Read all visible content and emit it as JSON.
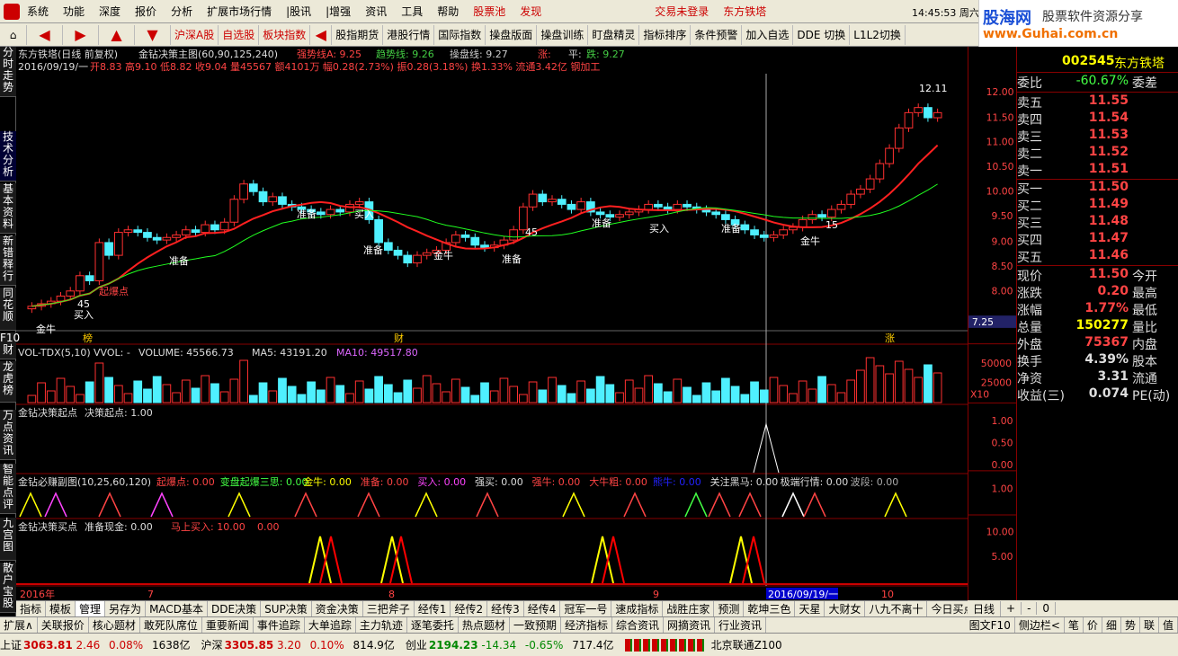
{
  "menu": [
    "系统",
    "功能",
    "深度",
    "报价",
    "分析",
    "扩展市场行情",
    "|股讯",
    "|增强",
    "资讯",
    "工具",
    "帮助",
    "股票池",
    "发现"
  ],
  "menu_right": {
    "login": "交易未登录",
    "stock": "东方铁塔",
    "time": "14:45:53 周六"
  },
  "logo": {
    "name": "股海网",
    "tagline": "股票软件资源分享",
    "url": "www.Guhai.com.cn"
  },
  "toolbar": [
    "沪深A股",
    "自选股",
    "板块指数",
    "股指期货",
    "港股行情",
    "国际指数",
    "操盘版面",
    "操盘训练",
    "盯盘精灵",
    "指标排序",
    "条件预警",
    "加入自选",
    "DDE 切换",
    "L1L2切换"
  ],
  "left_tabs": [
    "分时走势",
    "技术分析",
    "基本资料",
    "新错释行",
    "同花顺",
    "F10财",
    "龙虎榜",
    "万点资讯",
    "智能点评",
    "九宫图",
    "散户宝股"
  ],
  "header": {
    "title": "东方铁塔(日线 前复权)",
    "indicator": "金钻决策主图(60,90,125,240)",
    "s1": "强势线A: 9.25",
    "s2": "趋势线: 9.26",
    "s3": "操盘线: 9.27",
    "s4": "涨:",
    "s5": "平:",
    "s6": "跌: 9.27",
    "date": "2016/09/19/一",
    "quote": "开8.83 高9.10 低8.82 收9.04 量45567 额4101万 幅0.28(2.73%) 振0.28(3.18%) 换1.33% 流通3.42亿 钢加工"
  },
  "vol": {
    "name": "VOL-TDX(5,10)",
    "vvol": "VVOL: -",
    "volume": "VOLUME: 45566.73",
    "ma5": "MA5: 43191.20",
    "ma10": "MA10: 49517.80"
  },
  "p3": {
    "name": "金钻决策起点",
    "val": "决策起点: 1.00"
  },
  "p4": {
    "name": "金钻必赚副图(10,25,60,120)",
    "items": [
      "起爆点: 0.00",
      "变盘起爆三思: 0.00",
      "金牛: 0.00",
      "准备: 0.00",
      "买入: 0.00",
      "强买: 0.00",
      "强牛: 0.00",
      "大牛粗: 0.00",
      "熊牛: 0.00",
      "关注黑马: 0.00",
      "极端行情: 0.00",
      "波段: 0.00"
    ]
  },
  "p5": {
    "name": "金钻决策买点",
    "items": [
      "准备现金: 0.00",
      "马上买入: 10.00",
      "0.00"
    ]
  },
  "axis_main": [
    "12.00",
    "11.50",
    "11.00",
    "10.50",
    "10.00",
    "9.50",
    "9.00",
    "8.50",
    "8.00",
    "7.25"
  ],
  "axis_vol": [
    "50000",
    "25000",
    "X10"
  ],
  "axis_p3": [
    "1.00",
    "0.50",
    "0.00"
  ],
  "axis_p4": [
    "1.00"
  ],
  "axis_p5": [
    "10.00",
    "5.00"
  ],
  "time_axis": [
    "2016年",
    "7",
    "8",
    "9",
    "2016/09/19/一",
    "10"
  ],
  "right": {
    "code": "002545",
    "name": "东方铁塔",
    "wb": {
      "l": "委比",
      "v": "-60.67%",
      "r": "委差"
    },
    "asks": [
      {
        "l": "卖五",
        "v": "11.55"
      },
      {
        "l": "卖四",
        "v": "11.54"
      },
      {
        "l": "卖三",
        "v": "11.53"
      },
      {
        "l": "卖二",
        "v": "11.52"
      },
      {
        "l": "卖一",
        "v": "11.51"
      }
    ],
    "bids": [
      {
        "l": "买一",
        "v": "11.50"
      },
      {
        "l": "买二",
        "v": "11.49"
      },
      {
        "l": "买三",
        "v": "11.48"
      },
      {
        "l": "买四",
        "v": "11.47"
      },
      {
        "l": "买五",
        "v": "11.46"
      }
    ],
    "stats": [
      {
        "l": "现价",
        "v": "11.50",
        "r": "今开"
      },
      {
        "l": "涨跌",
        "v": "0.20",
        "r": "最高"
      },
      {
        "l": "涨幅",
        "v": "1.77%",
        "r": "最低"
      },
      {
        "l": "总量",
        "v": "150277",
        "r": "量比"
      },
      {
        "l": "外盘",
        "v": "75367",
        "r": "内盘"
      },
      {
        "l": "换手",
        "v": "4.39%",
        "r": "股本"
      },
      {
        "l": "净资",
        "v": "3.31",
        "r": "流通"
      },
      {
        "l": "收益(三)",
        "v": "0.074",
        "r": "PE(动)"
      }
    ]
  },
  "bottom_tabs": [
    "指标",
    "模板",
    "管理",
    "另存为",
    "MACD基本",
    "DDE决策",
    "SUP决策",
    "资金决策",
    "三把斧子",
    "经传1",
    "经传2",
    "经传3",
    "经传4",
    "冠军一号",
    "速成指标",
    "战胜庄家",
    "预测",
    "乾坤三色",
    "天星",
    "大财女",
    "八九不离十",
    "今日买点"
  ],
  "bottom_right": [
    "日线",
    "+",
    "-",
    "0"
  ],
  "bottom2": [
    "扩展∧",
    "关联报价",
    "核心题材",
    "敢死队席位",
    "重要新闻",
    "事件追踪",
    "大单追踪",
    "主力轨迹",
    "逐笔委托",
    "热点题材",
    "一致预期",
    "经济指标",
    "综合资讯",
    "网摘资讯",
    "行业资讯"
  ],
  "bottom2_right": [
    "图文F10",
    "侧边栏<",
    "笔",
    "价",
    "细",
    "势",
    "联",
    "值"
  ],
  "status": [
    {
      "l": "上证",
      "v": "3063.81",
      "c": "2.46",
      "p": "0.08%",
      "a": "1638亿"
    },
    {
      "l": "沪深",
      "v": "3305.85",
      "c": "3.20",
      "p": "0.10%",
      "a": "814.9亿"
    },
    {
      "l": "创业",
      "v": "2194.23",
      "c": "-14.34",
      "p": "-0.65%",
      "a": "717.4亿"
    }
  ],
  "status_server": "北京联通Z100",
  "marks": {
    "buy": "买入",
    "ready": "准备",
    "gold": "金牛",
    "boom": "起爆点",
    "n45": "45",
    "n15": "15",
    "hi": "12.11",
    "bang": "榜",
    "cai": "财",
    "zhang": "涨"
  }
}
